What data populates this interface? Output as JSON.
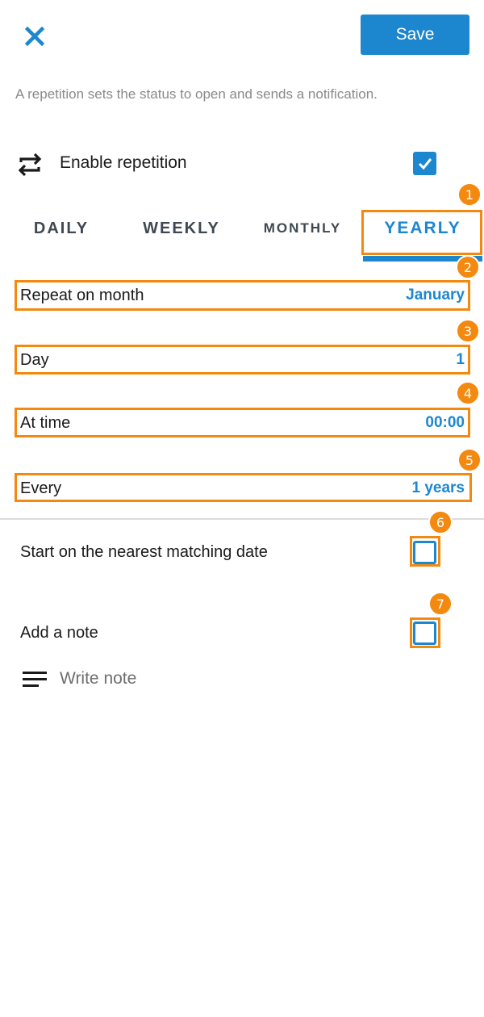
{
  "header": {
    "close_icon": "close-icon",
    "save_label": "Save"
  },
  "hint": "A repetition sets the status to open and sends a notification.",
  "enable": {
    "icon": "repeat-icon",
    "label": "Enable repetition",
    "checked": true
  },
  "tabs": [
    {
      "label": "DAILY",
      "active": false
    },
    {
      "label": "WEEKLY",
      "active": false
    },
    {
      "label": "MONTHLY",
      "active": false
    },
    {
      "label": "YEARLY",
      "active": true
    }
  ],
  "rows": {
    "month": {
      "label": "Repeat on month",
      "value": "January"
    },
    "day": {
      "label": "Day",
      "value": "1"
    },
    "time": {
      "label": "At time",
      "value": "00:00"
    },
    "every": {
      "label": "Every",
      "value": "1 years"
    }
  },
  "options": {
    "start_nearest": {
      "label": "Start on the nearest matching date",
      "checked": false
    },
    "add_note": {
      "label": "Add a note",
      "checked": false
    }
  },
  "note": {
    "icon": "notes-icon",
    "placeholder": "Write note"
  },
  "annotations": [
    "1",
    "2",
    "3",
    "4",
    "5",
    "6",
    "7"
  ],
  "colors": {
    "accent": "#1c87cf",
    "highlight": "#f3890f",
    "tab_text": "#3f4850",
    "hint_text": "#8a8a8a"
  }
}
